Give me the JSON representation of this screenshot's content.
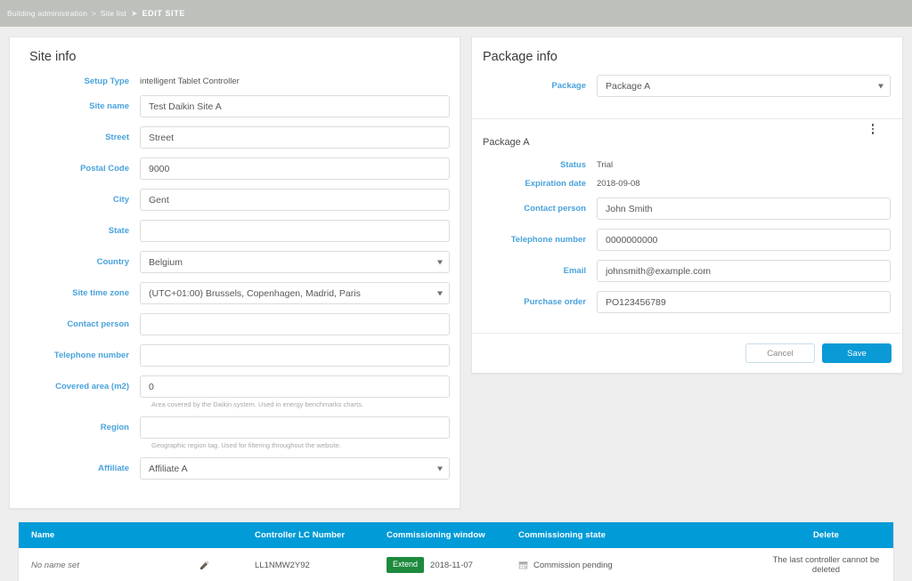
{
  "breadcrumb": {
    "root": "Building administration",
    "sep1": ">",
    "parent": "Site list",
    "sep2": "➤",
    "current": "EDIT SITE"
  },
  "site_info": {
    "title": "Site info",
    "fields": [
      {
        "label": "Setup Type",
        "type": "static",
        "value": "intelligent Tablet Controller"
      },
      {
        "label": "Site name",
        "type": "input",
        "value": "Test Daikin Site A",
        "placeholder": ""
      },
      {
        "label": "Street",
        "type": "input",
        "value": "Street",
        "placeholder": ""
      },
      {
        "label": "Postal Code",
        "type": "input",
        "value": "9000",
        "placeholder": ""
      },
      {
        "label": "City",
        "type": "input",
        "value": "Gent",
        "placeholder": ""
      },
      {
        "label": "State",
        "type": "input",
        "value": "",
        "placeholder": ""
      },
      {
        "label": "Country",
        "type": "select",
        "value": "Belgium"
      },
      {
        "label": "Site time zone",
        "type": "select",
        "value": "(UTC+01:00) Brussels, Copenhagen, Madrid, Paris"
      },
      {
        "label": "Contact person",
        "type": "input",
        "value": "",
        "placeholder": ""
      },
      {
        "label": "Telephone number",
        "type": "input",
        "value": "",
        "placeholder": ""
      },
      {
        "label": "Covered area (m2)",
        "type": "input",
        "value": "0",
        "placeholder": "",
        "hint": "Area covered by the Daikin system. Used in energy benchmarks charts."
      },
      {
        "label": "Region",
        "type": "input",
        "value": "",
        "placeholder": "",
        "hint": "Geographic region tag. Used for filtering throughout the website."
      },
      {
        "label": "Affiliate",
        "type": "select",
        "value": "Affiliate A"
      }
    ]
  },
  "package_info": {
    "title": "Package info",
    "package_label": "Package",
    "package_value": "Package A",
    "menu_icon": "kebab-menu-icon",
    "package_name": "Package A",
    "fields": [
      {
        "label": "Status",
        "type": "static",
        "value": "Trial"
      },
      {
        "label": "Expiration date",
        "type": "static",
        "value": "2018-09-08"
      },
      {
        "label": "Contact person",
        "type": "input",
        "value": "John Smith",
        "placeholder": ""
      },
      {
        "label": "Telephone number",
        "type": "input",
        "value": "0000000000",
        "placeholder": ""
      },
      {
        "label": "Email",
        "type": "input",
        "value": "johnsmith@example.com",
        "placeholder": ""
      },
      {
        "label": "Purchase order",
        "type": "input",
        "value": "PO123456789",
        "placeholder": ""
      }
    ],
    "cancel_label": "Cancel",
    "save_label": "Save"
  },
  "controllers_table": {
    "columns": [
      "Name",
      "Controller LC Number",
      "Commissioning window",
      "Commissioning state",
      "Delete"
    ],
    "rows": [
      {
        "name": "No name set",
        "edit_icon": "pencil-icon",
        "lc_number": "LL1NMW2Y92",
        "extend_label": "Extend",
        "window_date": "2018-11-07",
        "state_icon": "calendar-icon",
        "state": "Commission pending",
        "delete": "The last controller cannot be deleted"
      }
    ]
  },
  "colors": {
    "topbar": "#bec0bc",
    "label_blue": "#4aa3dc",
    "table_header_blue": "#019bd7",
    "save_blue": "#0a9ad6",
    "extend_green": "#1d8a3e",
    "page_bg": "#eeeeee"
  }
}
